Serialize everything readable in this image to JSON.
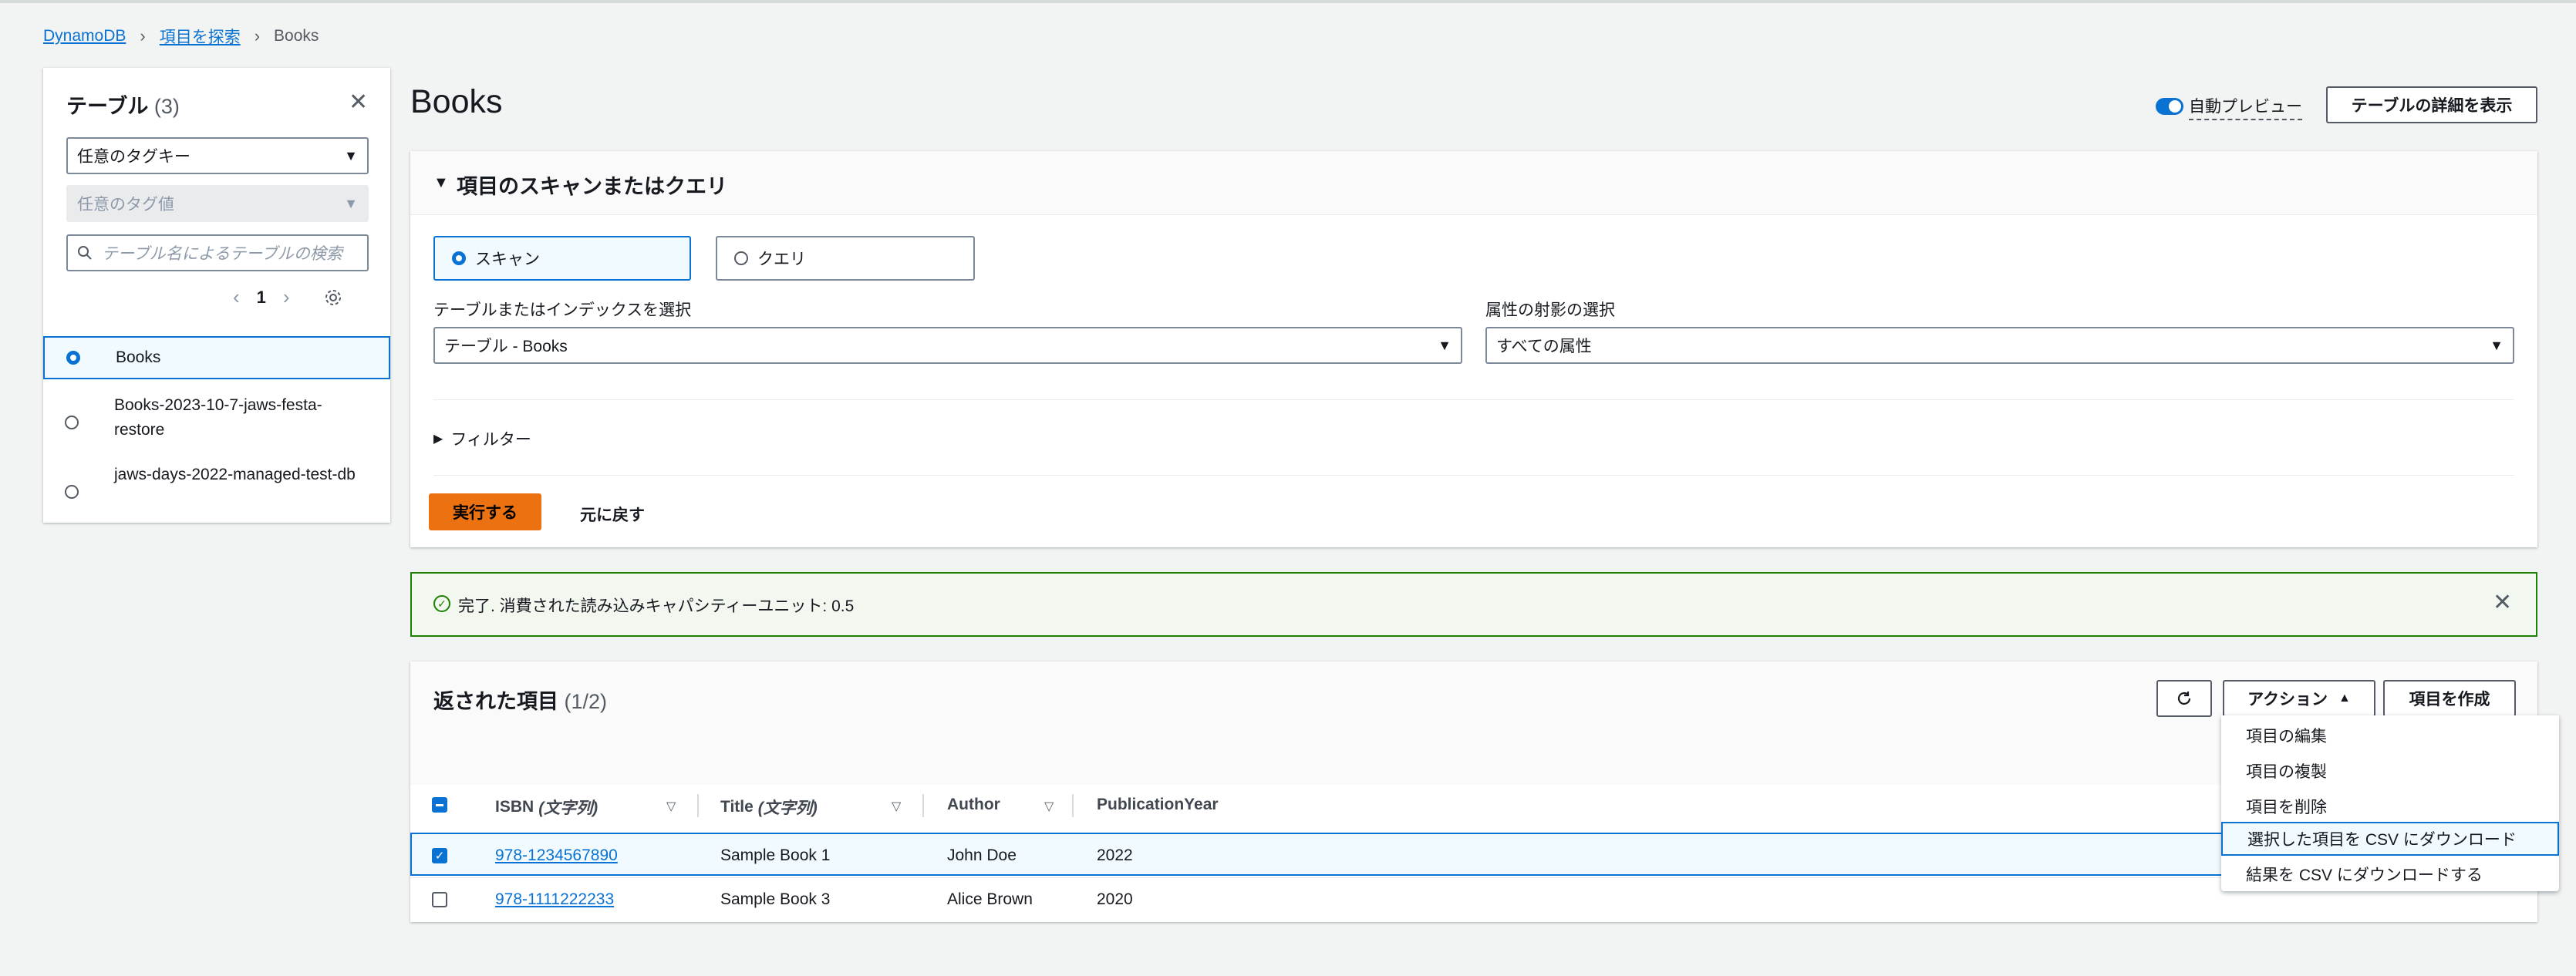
{
  "breadcrumb": {
    "root": "DynamoDB",
    "explore": "項目を探索",
    "current": "Books"
  },
  "sidebar": {
    "title": "テーブル",
    "count": "(3)",
    "tag_key_select": "任意のタグキー",
    "tag_value_select": "任意のタグ値",
    "search_placeholder": "テーブル名によるテーブルの検索",
    "page": "1",
    "tables": [
      {
        "name": "Books",
        "selected": true
      },
      {
        "name": "Books-2023-10-7-jaws-festa-restore",
        "selected": false
      },
      {
        "name": "jaws-days-2022-managed-test-db",
        "selected": false
      }
    ]
  },
  "main": {
    "title": "Books",
    "auto_preview_label": "自動プレビュー",
    "table_details_button": "テーブルの詳細を表示",
    "scan_query": {
      "heading": "項目のスキャンまたはクエリ",
      "scan_label": "スキャン",
      "query_label": "クエリ",
      "table_index_label": "テーブルまたはインデックスを選択",
      "table_index_value": "テーブル - Books",
      "projection_label": "属性の射影の選択",
      "projection_value": "すべての属性",
      "filters_label": "フィルター",
      "run_button": "実行する",
      "reset_button": "元に戻す"
    },
    "alert": {
      "message": "完了. 消費された読み込みキャパシティーユニット: 0.5"
    },
    "results": {
      "title": "返された項目",
      "count": "(1/2)",
      "actions_button": "アクション",
      "create_button": "項目を作成",
      "columns": [
        {
          "name": "ISBN",
          "type": "(文字列)"
        },
        {
          "name": "Title",
          "type": "(文字列)"
        },
        {
          "name": "Author",
          "type": ""
        },
        {
          "name": "PublicationYear",
          "type": ""
        }
      ],
      "rows": [
        {
          "isbn": "978-1234567890",
          "title": "Sample Book 1",
          "author": "John Doe",
          "year": "2022",
          "selected": true
        },
        {
          "isbn": "978-1111222233",
          "title": "Sample Book 3",
          "author": "Alice Brown",
          "year": "2020",
          "selected": false
        }
      ]
    },
    "actions_menu": [
      "項目の編集",
      "項目の複製",
      "項目を削除",
      "選択した項目を CSV にダウンロード",
      "結果を CSV にダウンロードする"
    ]
  },
  "colors": {
    "accent": "#0972d3",
    "primary_button": "#ec7211",
    "success": "#1d8102"
  }
}
